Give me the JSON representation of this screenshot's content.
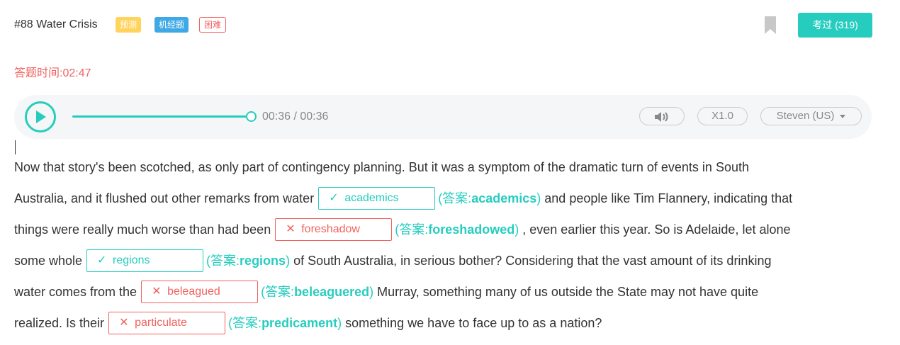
{
  "header": {
    "title": "#88 Water Crisis",
    "tags": [
      "预测",
      "机经题",
      "困难"
    ],
    "pass_button": "考过 (319)"
  },
  "timer": {
    "label": "答题时间:",
    "value": "02:47"
  },
  "player": {
    "progress_fraction": 1.0,
    "time": "00:36 / 00:36",
    "speed": "X1.0",
    "voice": "Steven (US)"
  },
  "colors": {
    "accent": "#26cdbf",
    "error": "#f0635f",
    "tag_yellow": "#ffd35c",
    "tag_blue": "#3fa9e6"
  },
  "answer_prefix": "(答案:",
  "passage": {
    "line1": "Now that story's been scotched, as only part of contingency planning. But it was a symptom of the dramatic turn of events in South",
    "line2_pre": "Australia, and it flushed out other remarks from water",
    "line2_post": "and people like Tim Flannery, indicating that",
    "line3_pre": "things were really much worse than had been",
    "line3_post": ", even earlier this year. So is Adelaide, let alone",
    "line4_pre": "some whole",
    "line4_post": "of South Australia, in serious bother? Considering that the vast amount of its drinking",
    "line5_pre": "water comes from the",
    "line5_post": "Murray, something many of us outside the State may not have quite",
    "line6_pre": "realized. Is their",
    "line6_post": "something we have to face up to as a nation?"
  },
  "blanks": [
    {
      "input": "academics",
      "answer": "academics",
      "correct": true,
      "mark": "✓"
    },
    {
      "input": "foreshadow",
      "answer": "foreshadowed",
      "correct": false,
      "mark": "✕"
    },
    {
      "input": "regions",
      "answer": "regions",
      "correct": true,
      "mark": "✓"
    },
    {
      "input": "beleagued",
      "answer": "beleaguered",
      "correct": false,
      "mark": "✕"
    },
    {
      "input": "particulate",
      "answer": "predicament",
      "correct": false,
      "mark": "✕"
    }
  ]
}
